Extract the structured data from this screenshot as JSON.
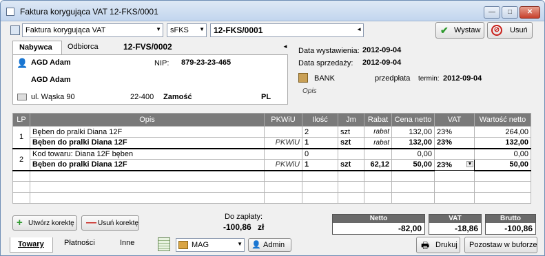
{
  "window": {
    "title": "Faktura korygująca VAT 12-FKS/0001",
    "min_label": "—",
    "max_label": "□",
    "close_label": "✕"
  },
  "toolbar": {
    "doc_type": "Faktura korygująca VAT",
    "series": "sFKS",
    "number": "12-FKS/0001",
    "issue_button": "Wystaw",
    "cancel_button": "Usuń"
  },
  "party": {
    "tabs": [
      "Nabywca",
      "Odbiorca"
    ],
    "source_doc": "12-FVS/0002",
    "name": "AGD Adam",
    "nip_label": "NIP:",
    "nip": "879-23-23-465",
    "name2": "AGD Adam",
    "street": "ul. Wąska 90",
    "postcode": "22-400",
    "city": "Zamość",
    "country": "PL"
  },
  "dates": {
    "issue_label": "Data wystawienia:",
    "issue_value": "2012-09-04",
    "sale_label": "Data sprzedaży:",
    "sale_value": "2012-09-04",
    "bank": "BANK",
    "payment_method": "przedpłata",
    "term_label": "termin:",
    "term_value": "2012-09-04",
    "notes_placeholder": "Opis"
  },
  "grid": {
    "headers": [
      "LP",
      "Opis",
      "PKWiU",
      "Ilość",
      "Jm",
      "Rabat",
      "Cena netto",
      "VAT",
      "Wartość netto"
    ],
    "rows": [
      {
        "lp": "1",
        "opis": "Bęben do pralki Diana 12F",
        "pkwiu": "",
        "ilosc": "2",
        "jm": "szt",
        "rabat": "rabat",
        "cena": "132,00",
        "vat": "23%",
        "wartosc": "264,00",
        "bold": false
      },
      {
        "lp": "",
        "opis": "Bęben do pralki Diana 12F",
        "pkwiu": "PKWiU",
        "ilosc": "1",
        "jm": "szt",
        "rabat": "rabat",
        "cena": "132,00",
        "vat": "23%",
        "wartosc": "132,00",
        "bold": true
      },
      {
        "lp": "2",
        "opis": "Kod towaru: Diana 12F bęben",
        "pkwiu": "",
        "ilosc": "0",
        "jm": "",
        "rabat": "",
        "cena": "0,00",
        "vat": "",
        "wartosc": "0,00",
        "bold": false
      },
      {
        "lp": "",
        "opis": "Bęben do pralki Diana 12F",
        "pkwiu": "PKWiU",
        "ilosc": "1",
        "jm": "szt",
        "rabat": "62,12",
        "cena": "50,00",
        "vat": "23%",
        "wartosc": "50,00",
        "bold": true
      }
    ]
  },
  "actions": {
    "create_correction": "Utwórz korektę",
    "delete_correction": "Usuń korektę"
  },
  "totals": {
    "to_pay_label": "Do zapłaty:",
    "to_pay_value": "-100,86",
    "currency": "zł",
    "netto_label": "Netto",
    "netto_value": "-82,00",
    "vat_label": "VAT",
    "vat_value": "-18,86",
    "brutto_label": "Brutto",
    "brutto_value": "-100,86"
  },
  "bottom": {
    "tabs": [
      "Towary",
      "Płatności",
      "Inne"
    ],
    "warehouse": "MAG",
    "user": "Admin",
    "print_button": "Drukuj",
    "buffer_button": "Pozostaw w buforze"
  },
  "colors": {
    "accent": "#6e8db4",
    "grid_header": "#7a7a7a",
    "issue_icon": "#2e9a2e",
    "cancel_icon": "#c8201a"
  }
}
